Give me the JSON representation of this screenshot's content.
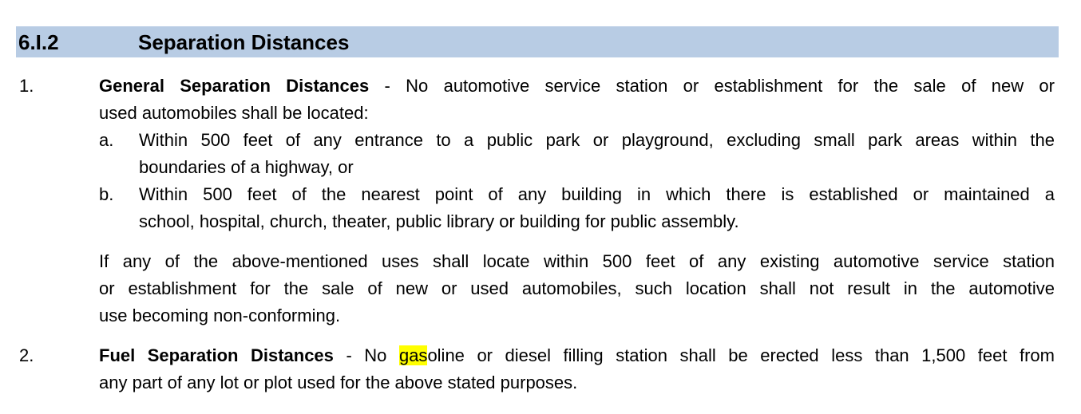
{
  "section": {
    "number": "6.I.2",
    "title": "Separation Distances",
    "bar_color": "#b8cce4"
  },
  "items": [
    {
      "number": "1.",
      "heading": "General Separation Distances",
      "dash": " - ",
      "line1_rest": "No automotive service station or establishment for the sale of new or",
      "line2": "used automobiles shall be located:",
      "subitems": [
        {
          "letter": "a.",
          "line1": "Within 500 feet of any entrance to a public park or playground, excluding small park areas within the",
          "line2": "boundaries of a highway, or"
        },
        {
          "letter": "b.",
          "line1": "Within 500 feet of the nearest point of any building in which there is established or maintained a",
          "line2": "school, hospital,  church, theater, public library or building for public assembly."
        }
      ],
      "followup": {
        "line1": "If any of the above-mentioned uses shall locate within 500 feet of any existing automotive service station",
        "line2": "or establishment for the sale of new or used automobiles, such location shall not result in the automotive",
        "line3": "use becoming non-conforming."
      }
    },
    {
      "number": "2.",
      "heading": "Fuel Separation Distances",
      "dash": " - ",
      "before_highlight": "No ",
      "highlight": "gas",
      "after_highlight": "oline or diesel filling station shall be erected less than 1,500 feet from",
      "line2": "any part of any lot or plot used for the above stated purposes.",
      "highlight_color": "#ffff00"
    }
  ]
}
